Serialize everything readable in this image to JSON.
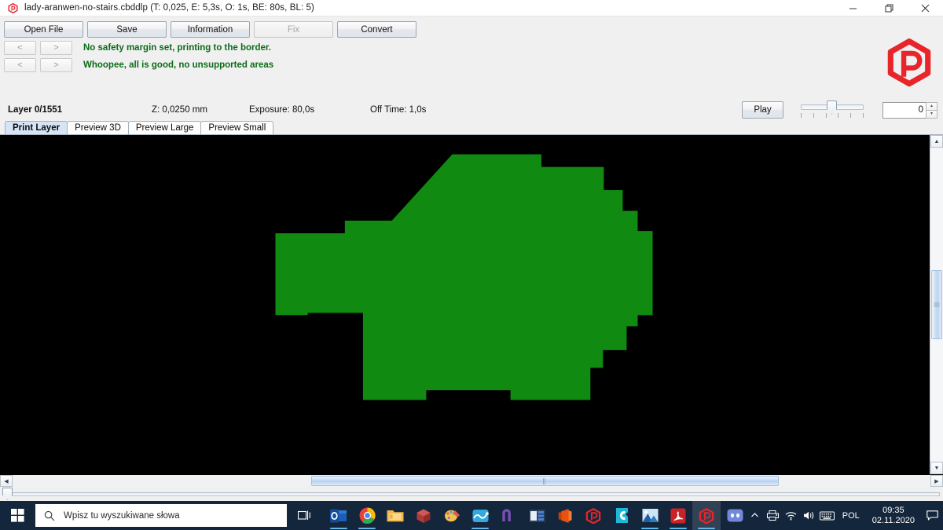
{
  "window": {
    "app_icon": "uvtools-hex-p-icon",
    "title": "lady-aranwen-no-stairs.cbddlp (T: 0,025, E: 5,3s, O: 1s, BE: 80s, BL: 5)",
    "minimize_label": "—",
    "maximize_label": "❐",
    "close_label": "✕"
  },
  "toolbar": {
    "buttons": [
      {
        "label": "Open File",
        "enabled": true
      },
      {
        "label": "Save",
        "enabled": true
      },
      {
        "label": "Information",
        "enabled": true
      },
      {
        "label": "Fix",
        "enabled": false
      },
      {
        "label": "Convert",
        "enabled": true
      }
    ],
    "nav": {
      "row1_prev": "<",
      "row1_next": ">",
      "row2_prev": "<",
      "row2_next": ">"
    },
    "status_line_1": "No safety margin set, printing to the border.",
    "status_line_2": "Whoopee, all is good, no unsupported areas",
    "status_color": "#0b6b18",
    "brand_logo": "uvtools-hex-p-logo",
    "brand_color": "#e8252a"
  },
  "info": {
    "layer": "Layer 0/1551",
    "z": "Z: 0,0250 mm",
    "exposure": "Exposure: 80,0s",
    "off_time": "Off Time: 1,0s",
    "play_label": "Play",
    "layer_value": "0",
    "spin_up": "▴",
    "spin_down": "▾"
  },
  "tabs": [
    {
      "label": "Print Layer",
      "active": true
    },
    {
      "label": "Preview 3D",
      "active": false
    },
    {
      "label": "Preview Large",
      "active": false
    },
    {
      "label": "Preview Small",
      "active": false
    }
  ],
  "viewport": {
    "background": "#000000",
    "layer_color": "#108a10",
    "scroll_up": "▲",
    "scroll_down": "▼",
    "scroll_left": "◀",
    "scroll_right": "▶"
  },
  "taskbar": {
    "start_label": "start-menu",
    "search_placeholder": "Wpisz tu wyszukiwane słowa",
    "apps": [
      {
        "name": "outlook",
        "running": true,
        "active": false
      },
      {
        "name": "google-chrome",
        "running": true,
        "active": false
      },
      {
        "name": "file-explorer",
        "running": false,
        "active": false
      },
      {
        "name": "3d-viewer",
        "running": false,
        "active": false
      },
      {
        "name": "paint-3d",
        "running": false,
        "active": false
      },
      {
        "name": "weather",
        "running": true,
        "active": false
      },
      {
        "name": "onenote",
        "running": false,
        "active": false
      },
      {
        "name": "media-app",
        "running": false,
        "active": false
      },
      {
        "name": "office",
        "running": false,
        "active": false
      },
      {
        "name": "uvtools",
        "running": false,
        "active": false
      },
      {
        "name": "chitubox",
        "running": false,
        "active": false
      },
      {
        "name": "photos",
        "running": true,
        "active": false
      },
      {
        "name": "adobe-acrobat",
        "running": true,
        "active": false
      },
      {
        "name": "uvtools-open",
        "running": true,
        "active": true
      },
      {
        "name": "discord",
        "running": false,
        "active": false
      }
    ],
    "tray": {
      "show_hidden": "⌃",
      "icons": [
        "printer-icon",
        "wifi-icon",
        "volume-icon",
        "keyboard-icon"
      ],
      "language": "POL",
      "time": "09:35",
      "date": "02.11.2020",
      "action_center": "notification-icon"
    }
  }
}
